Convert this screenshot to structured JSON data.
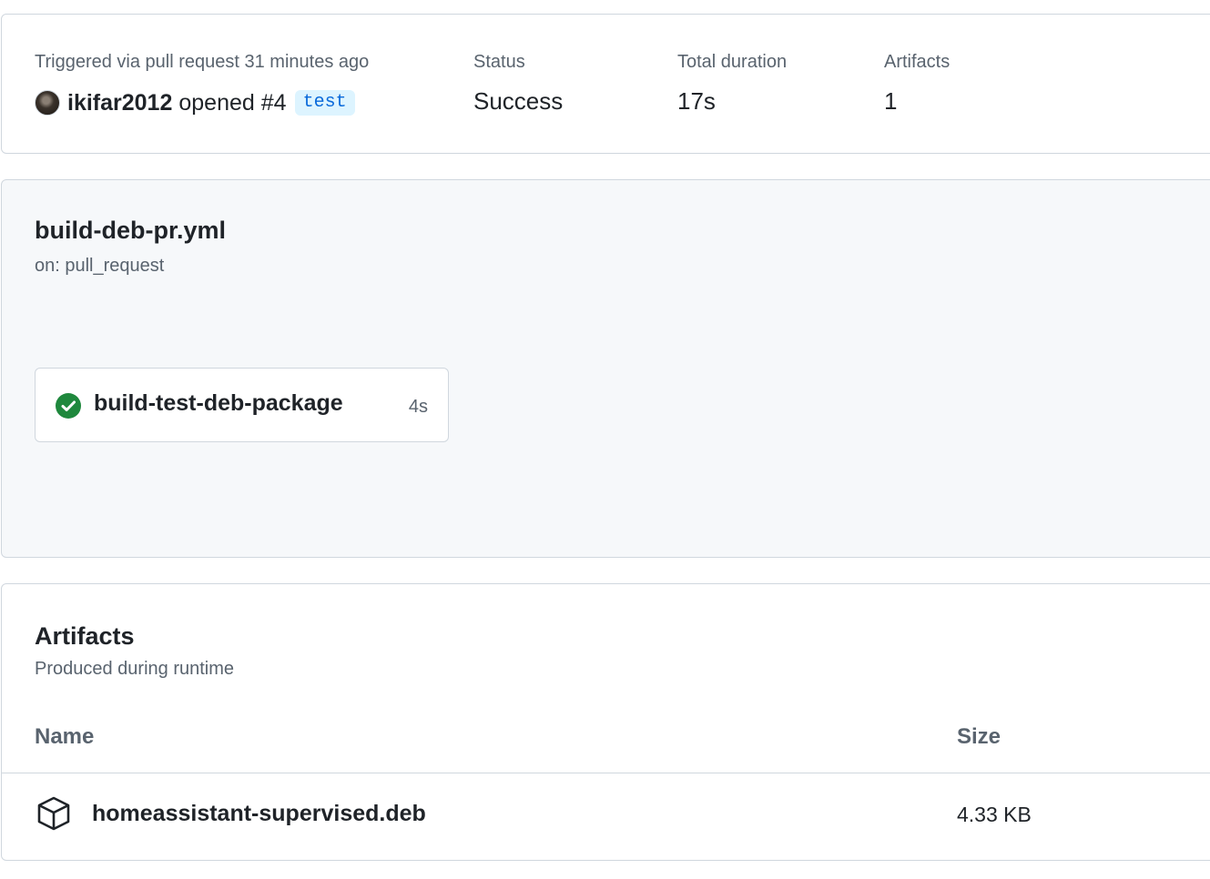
{
  "summary": {
    "trigger_text": "Triggered via pull request 31 minutes ago",
    "actor": "ikifar2012",
    "action": "opened #4",
    "branch": "test",
    "status_label": "Status",
    "status_value": "Success",
    "duration_label": "Total duration",
    "duration_value": "17s",
    "artifacts_label": "Artifacts",
    "artifacts_value": "1"
  },
  "workflow": {
    "file_name": "build-deb-pr.yml",
    "trigger": "on: pull_request",
    "jobs": [
      {
        "name": "build-test-deb-package",
        "duration": "4s",
        "status": "success",
        "icon": "check-circle-icon"
      }
    ]
  },
  "artifacts": {
    "title": "Artifacts",
    "subtitle": "Produced during runtime",
    "columns": {
      "name": "Name",
      "size": "Size"
    },
    "rows": [
      {
        "name": "homeassistant-supervised.deb",
        "size": "4.33 KB",
        "icon": "package-icon"
      }
    ]
  },
  "colors": {
    "success": "#1f883d",
    "link": "#0969da",
    "branch_bg": "#ddf4ff",
    "border": "#d0d7de",
    "muted_text": "#59636e"
  }
}
